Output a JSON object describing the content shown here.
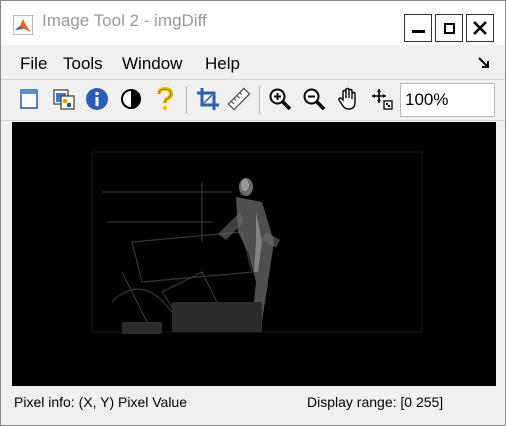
{
  "window": {
    "title": "Image Tool 2 - imgDiff",
    "controls": [
      "minimize",
      "maximize",
      "close"
    ]
  },
  "menubar": {
    "items": [
      "File",
      "Tools",
      "Window",
      "Help"
    ]
  },
  "toolbar": {
    "buttons": [
      {
        "icon": "new-figure-icon"
      },
      {
        "icon": "export-image-icon"
      },
      {
        "icon": "image-information-icon"
      },
      {
        "icon": "adjust-contrast-icon"
      },
      {
        "icon": "help-icon"
      },
      {
        "icon": "crop-icon"
      },
      {
        "icon": "measure-distance-icon"
      },
      {
        "icon": "zoom-in-icon"
      },
      {
        "icon": "zoom-out-icon"
      },
      {
        "icon": "pan-icon"
      },
      {
        "icon": "pixel-region-icon"
      }
    ],
    "zoom_value": "100%"
  },
  "status": {
    "pixel_info": "Pixel info: (X, Y)  Pixel Value",
    "display_range": "Display range: [0 255]"
  },
  "colors": {
    "image_background": "#000000",
    "info_blue": "#2a5db8",
    "help_yellow": "#f2c200",
    "crop_blue": "#2f5fa8"
  }
}
